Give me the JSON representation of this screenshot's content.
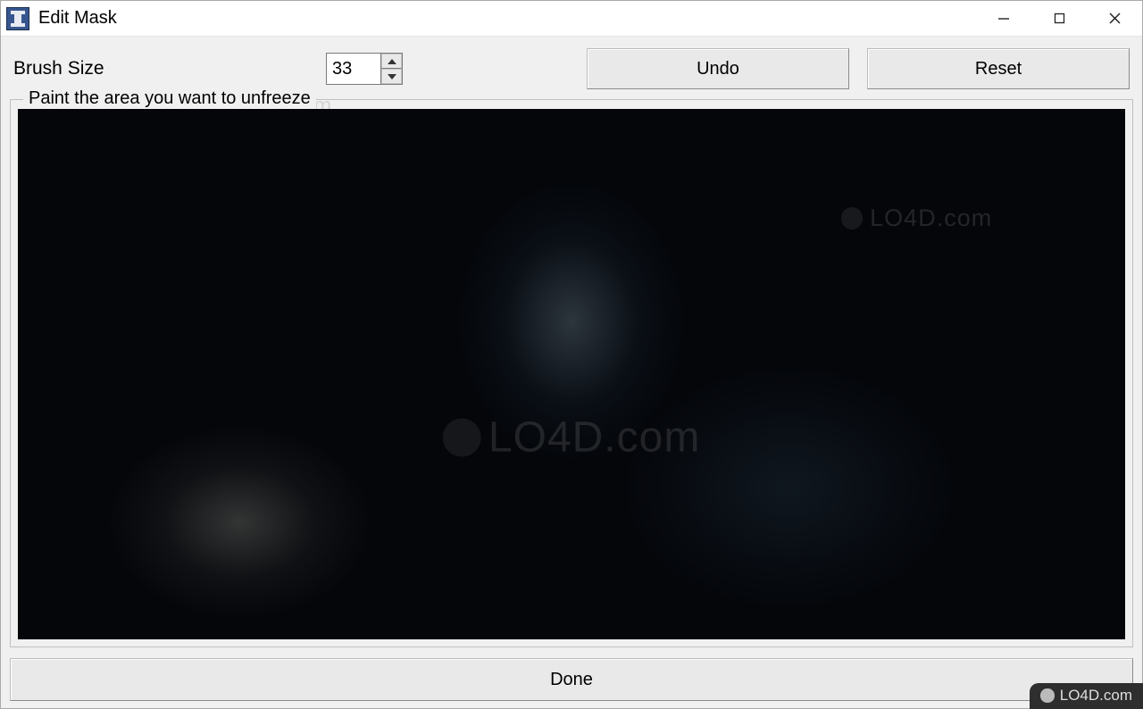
{
  "window": {
    "title": "Edit Mask"
  },
  "toolbar": {
    "brush_size_label": "Brush Size",
    "brush_size_value": "33",
    "undo_label": "Undo",
    "reset_label": "Reset"
  },
  "group": {
    "legend": "Paint the area you want to unfreeze"
  },
  "footer": {
    "done_label": "Done"
  },
  "watermark": {
    "text": "LO4D.com"
  }
}
